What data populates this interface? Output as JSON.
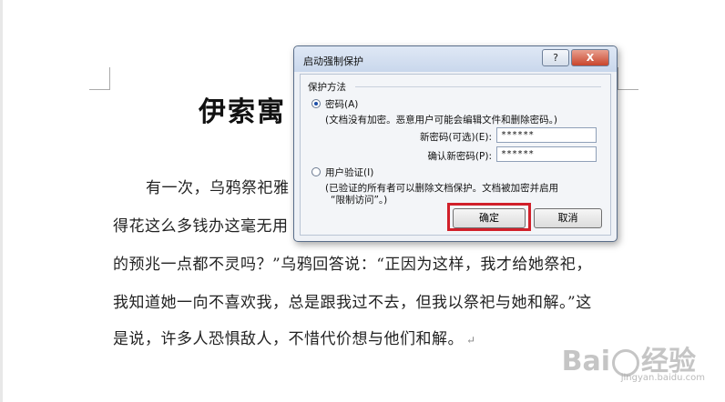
{
  "document": {
    "title": "伊索寓",
    "lines": [
      "有一次，乌鸦祭祀雅",
      "得花这么多钱办这毫无用",
      "的预兆一点都不灵吗？”乌鸦回答说：“正因为这样，我才给她祭祀，",
      "我知道她一向不喜欢我，总是跟我过不去，但我以祭祀与她和解。”这",
      "是说，许多人恐惧敌人，不惜代价想与他们和解。"
    ],
    "paragraph_mark": "↵"
  },
  "dialog": {
    "title": "启动强制保护",
    "help_label": "?",
    "close_label": "X",
    "group_label": "保护方法",
    "password_option": {
      "label": "密码(A)",
      "selected": true,
      "description": "(文档没有加密。恶意用户可能会编辑文件和删除密码。)",
      "new_password_label": "新密码(可选)(E):",
      "new_password_value": "******",
      "confirm_password_label": "确认新密码(P):",
      "confirm_password_value": "******"
    },
    "user_auth_option": {
      "label": "用户验证(I)",
      "selected": false,
      "description_line1": "(已验证的所有者可以删除文档保护。文档被加密并启用",
      "description_line2": "“限制访问”。)"
    },
    "ok_label": "确定",
    "cancel_label": "取消",
    "highlight_color": "#d1202a"
  },
  "watermark": {
    "text_left": "Bai",
    "text_right": "经验",
    "url": "jingyan.baidu.com"
  }
}
